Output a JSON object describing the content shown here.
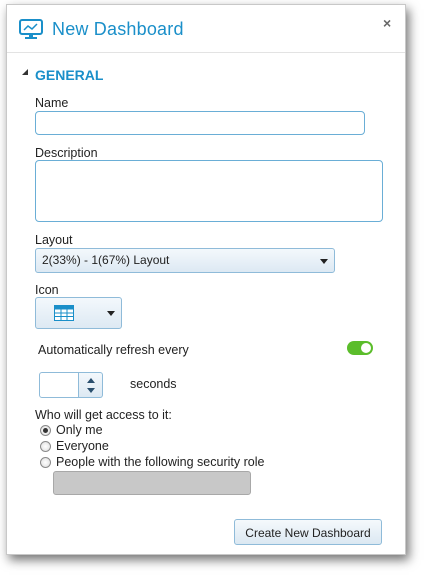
{
  "dialog": {
    "title": "New Dashboard",
    "close_glyph": "×",
    "icons": {
      "title": "monitor-icon",
      "close": "close-icon"
    }
  },
  "section": {
    "title": "GENERAL",
    "collapse_icon": "triangle-down-icon"
  },
  "form": {
    "name": {
      "label": "Name",
      "value": ""
    },
    "description": {
      "label": "Description",
      "value": ""
    },
    "layout": {
      "label": "Layout",
      "selected": "2(33%) - 1(67%) Layout"
    },
    "icon": {
      "label": "Icon",
      "selected_icon": "grid-table-icon"
    },
    "auto_refresh": {
      "label": "Automatically refresh every",
      "enabled": true,
      "interval_value": "",
      "unit": "seconds"
    },
    "access": {
      "label": "Who will get access to it:",
      "options": [
        "Only me",
        "Everyone",
        "People with the following security role"
      ],
      "selected": "Only me",
      "role_value": ""
    }
  },
  "buttons": {
    "create": "Create New Dashboard"
  },
  "colors": {
    "accent": "#1a8fc9",
    "toggle_on": "#5bbd2b",
    "field_border": "#6aaed6"
  }
}
